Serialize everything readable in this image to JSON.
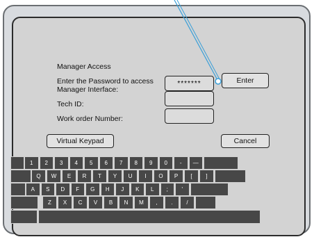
{
  "dialog": {
    "title": "Manager Access",
    "password_label": "Enter the Password to access Manager Interface:",
    "password_label_line1": "Enter the Password to access",
    "password_label_line2": "Manager Interface:",
    "password_value": "*******",
    "tech_id_label": "Tech ID:",
    "tech_id_value": "",
    "work_order_label": "Work order Number:",
    "work_order_value": "",
    "enter_button": "Enter",
    "virtual_keypad_button": "Virtual Keypad",
    "cancel_button": "Cancel"
  },
  "keyboard": {
    "row1": [
      "1",
      "2",
      "3",
      "4",
      "5",
      "6",
      "7",
      "8",
      "9",
      "0",
      "-",
      "—"
    ],
    "row2": [
      "Q",
      "W",
      "E",
      "R",
      "T",
      "Y",
      "U",
      "I",
      "O",
      "P",
      "[",
      "]"
    ],
    "row3": [
      "A",
      "S",
      "D",
      "F",
      "G",
      "H",
      "J",
      "K",
      "L",
      ";",
      "'"
    ],
    "row4": [
      "Z",
      "X",
      "C",
      "V",
      "B",
      "N",
      "M",
      ",",
      ".",
      "/"
    ]
  },
  "colors": {
    "screen_bg": "#d3d3d3",
    "key_bg": "#474747",
    "callout": "#3a9fd8"
  }
}
